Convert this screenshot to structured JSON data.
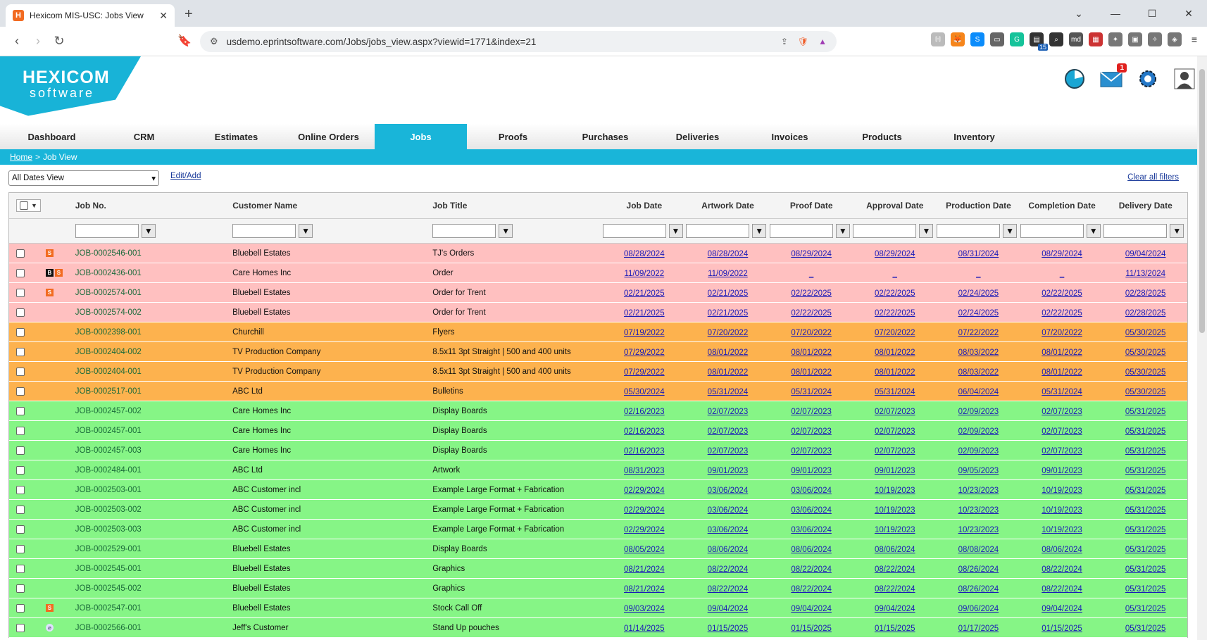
{
  "browser": {
    "tab_title": "Hexicom MIS-USC: Jobs View",
    "favicon_letter": "H",
    "url": "usdemo.eprintsoftware.com/Jobs/jobs_view.aspx?viewid=1771&index=21",
    "ext_badge": "15"
  },
  "app": {
    "logo_title": "HEXICOM",
    "logo_sub": "software",
    "mail_badge": "1"
  },
  "nav": [
    "Dashboard",
    "CRM",
    "Estimates",
    "Online Orders",
    "Jobs",
    "Proofs",
    "Purchases",
    "Deliveries",
    "Invoices",
    "Products",
    "Inventory"
  ],
  "nav_active": "Jobs",
  "breadcrumb": {
    "home": "Home",
    "sep": ">",
    "current": "Job View"
  },
  "controls": {
    "view_select": "All Dates View",
    "edit_add": "Edit/Add",
    "clear_filters": "Clear all filters"
  },
  "columns": {
    "job_no": "Job No.",
    "customer": "Customer Name",
    "title": "Job Title",
    "job_date": "Job Date",
    "artwork_date": "Artwork Date",
    "proof_date": "Proof Date",
    "approval_date": "Approval Date",
    "production_date": "Production Date",
    "completion_date": "Completion Date",
    "delivery_date": "Delivery Date"
  },
  "rows": [
    {
      "color": "red",
      "icons": [
        "S"
      ],
      "job": "JOB-0002546-001",
      "customer": "Bluebell Estates",
      "title": "TJ's Orders",
      "dates": [
        "08/28/2024",
        "08/28/2024",
        "08/29/2024",
        "08/29/2024",
        "08/31/2024",
        "08/29/2024",
        "09/04/2024"
      ]
    },
    {
      "color": "red",
      "icons": [
        "B",
        "S"
      ],
      "job": "JOB-0002436-001",
      "customer": "Care Homes Inc",
      "title": "Order",
      "dates": [
        "11/09/2022",
        "11/09/2022",
        "_",
        "_",
        "_",
        "_",
        "11/13/2024"
      ]
    },
    {
      "color": "red",
      "icons": [
        "S"
      ],
      "job": "JOB-0002574-001",
      "customer": "Bluebell Estates",
      "title": "Order for Trent",
      "dates": [
        "02/21/2025",
        "02/21/2025",
        "02/22/2025",
        "02/22/2025",
        "02/24/2025",
        "02/22/2025",
        "02/28/2025"
      ]
    },
    {
      "color": "red",
      "icons": [],
      "job": "JOB-0002574-002",
      "customer": "Bluebell Estates",
      "title": "Order for Trent",
      "dates": [
        "02/21/2025",
        "02/21/2025",
        "02/22/2025",
        "02/22/2025",
        "02/24/2025",
        "02/22/2025",
        "02/28/2025"
      ]
    },
    {
      "color": "orange",
      "icons": [],
      "job": "JOB-0002398-001",
      "customer": "Churchill",
      "title": "Flyers",
      "dates": [
        "07/19/2022",
        "07/20/2022",
        "07/20/2022",
        "07/20/2022",
        "07/22/2022",
        "07/20/2022",
        "05/30/2025"
      ]
    },
    {
      "color": "orange",
      "icons": [],
      "job": "JOB-0002404-002",
      "customer": "TV Production Company",
      "title": "8.5x11 3pt Straight | 500 and 400 units",
      "dates": [
        "07/29/2022",
        "08/01/2022",
        "08/01/2022",
        "08/01/2022",
        "08/03/2022",
        "08/01/2022",
        "05/30/2025"
      ]
    },
    {
      "color": "orange",
      "icons": [],
      "job": "JOB-0002404-001",
      "customer": "TV Production Company",
      "title": "8.5x11 3pt Straight | 500 and 400 units",
      "dates": [
        "07/29/2022",
        "08/01/2022",
        "08/01/2022",
        "08/01/2022",
        "08/03/2022",
        "08/01/2022",
        "05/30/2025"
      ]
    },
    {
      "color": "orange",
      "icons": [],
      "job": "JOB-0002517-001",
      "customer": "ABC Ltd",
      "title": "Bulletins",
      "dates": [
        "05/30/2024",
        "05/31/2024",
        "05/31/2024",
        "05/31/2024",
        "06/04/2024",
        "05/31/2024",
        "05/30/2025"
      ]
    },
    {
      "color": "green",
      "icons": [],
      "job": "JOB-0002457-002",
      "customer": "Care Homes Inc",
      "title": "Display Boards",
      "dates": [
        "02/16/2023",
        "02/07/2023",
        "02/07/2023",
        "02/07/2023",
        "02/09/2023",
        "02/07/2023",
        "05/31/2025"
      ]
    },
    {
      "color": "green",
      "icons": [],
      "job": "JOB-0002457-001",
      "customer": "Care Homes Inc",
      "title": "Display Boards",
      "dates": [
        "02/16/2023",
        "02/07/2023",
        "02/07/2023",
        "02/07/2023",
        "02/09/2023",
        "02/07/2023",
        "05/31/2025"
      ]
    },
    {
      "color": "green",
      "icons": [],
      "job": "JOB-0002457-003",
      "customer": "Care Homes Inc",
      "title": "Display Boards",
      "dates": [
        "02/16/2023",
        "02/07/2023",
        "02/07/2023",
        "02/07/2023",
        "02/09/2023",
        "02/07/2023",
        "05/31/2025"
      ]
    },
    {
      "color": "green",
      "icons": [],
      "job": "JOB-0002484-001",
      "customer": "ABC Ltd",
      "title": "Artwork",
      "dates": [
        "08/31/2023",
        "09/01/2023",
        "09/01/2023",
        "09/01/2023",
        "09/05/2023",
        "09/01/2023",
        "05/31/2025"
      ]
    },
    {
      "color": "green",
      "icons": [],
      "job": "JOB-0002503-001",
      "customer": "ABC Customer incl",
      "title": "Example Large Format + Fabrication",
      "dates": [
        "02/29/2024",
        "03/06/2024",
        "03/06/2024",
        "10/19/2023",
        "10/23/2023",
        "10/19/2023",
        "05/31/2025"
      ]
    },
    {
      "color": "green",
      "icons": [],
      "job": "JOB-0002503-002",
      "customer": "ABC Customer incl",
      "title": "Example Large Format + Fabrication",
      "dates": [
        "02/29/2024",
        "03/06/2024",
        "03/06/2024",
        "10/19/2023",
        "10/23/2023",
        "10/19/2023",
        "05/31/2025"
      ]
    },
    {
      "color": "green",
      "icons": [],
      "job": "JOB-0002503-003",
      "customer": "ABC Customer incl",
      "title": "Example Large Format + Fabrication",
      "dates": [
        "02/29/2024",
        "03/06/2024",
        "03/06/2024",
        "10/19/2023",
        "10/23/2023",
        "10/19/2023",
        "05/31/2025"
      ]
    },
    {
      "color": "green",
      "icons": [],
      "job": "JOB-0002529-001",
      "customer": "Bluebell Estates",
      "title": "Display Boards",
      "dates": [
        "08/05/2024",
        "08/06/2024",
        "08/06/2024",
        "08/06/2024",
        "08/08/2024",
        "08/06/2024",
        "05/31/2025"
      ]
    },
    {
      "color": "green",
      "icons": [],
      "job": "JOB-0002545-001",
      "customer": "Bluebell Estates",
      "title": "Graphics",
      "dates": [
        "08/21/2024",
        "08/22/2024",
        "08/22/2024",
        "08/22/2024",
        "08/26/2024",
        "08/22/2024",
        "05/31/2025"
      ]
    },
    {
      "color": "green",
      "icons": [],
      "job": "JOB-0002545-002",
      "customer": "Bluebell Estates",
      "title": "Graphics",
      "dates": [
        "08/21/2024",
        "08/22/2024",
        "08/22/2024",
        "08/22/2024",
        "08/26/2024",
        "08/22/2024",
        "05/31/2025"
      ]
    },
    {
      "color": "green",
      "icons": [
        "S"
      ],
      "job": "JOB-0002547-001",
      "customer": "Bluebell Estates",
      "title": "Stock Call Off",
      "dates": [
        "09/03/2024",
        "09/04/2024",
        "09/04/2024",
        "09/04/2024",
        "09/06/2024",
        "09/04/2024",
        "05/31/2025"
      ]
    },
    {
      "color": "green",
      "icons": [
        "P"
      ],
      "job": "JOB-0002566-001",
      "customer": "Jeff's Customer",
      "title": "Stand Up pouches",
      "dates": [
        "01/14/2025",
        "01/15/2025",
        "01/15/2025",
        "01/15/2025",
        "01/17/2025",
        "01/15/2025",
        "05/31/2025"
      ]
    }
  ],
  "colors": {
    "accent": "#19b5d9",
    "red_row": "#ffc0c0",
    "orange_row": "#fdb24e",
    "green_row": "#86f586"
  }
}
